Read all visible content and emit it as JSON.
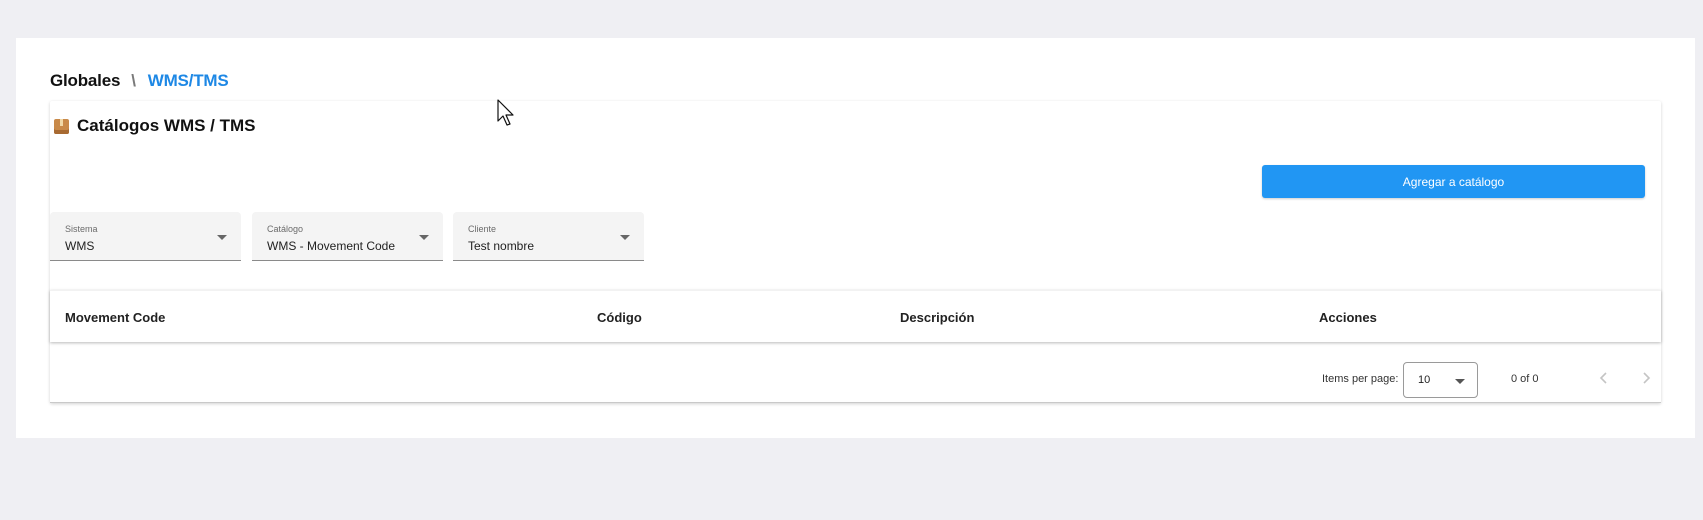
{
  "breadcrumb": {
    "root": "Globales",
    "separator": "\\",
    "current": "WMS/TMS"
  },
  "panel": {
    "title": "Catálogos WMS / TMS",
    "title_icon": "package-icon"
  },
  "add_button": {
    "label": "Agregar a catálogo"
  },
  "filters": {
    "sistema": {
      "label": "Sistema",
      "value": "WMS"
    },
    "catalogo": {
      "label": "Catálogo",
      "value": "WMS - Movement Code"
    },
    "cliente": {
      "label": "Cliente",
      "value": "Test nombre"
    }
  },
  "table": {
    "columns": [
      "Movement Code",
      "Código",
      "Descripción",
      "Acciones"
    ],
    "rows": []
  },
  "paginator": {
    "items_per_page_label": "Items per page:",
    "items_per_page_value": "10",
    "range_label": "0 of 0",
    "prev_icon": "chevron-left-icon",
    "next_icon": "chevron-right-icon"
  },
  "colors": {
    "accent": "#1e88e5",
    "button": "#2196f3",
    "background": "#efeff3"
  }
}
